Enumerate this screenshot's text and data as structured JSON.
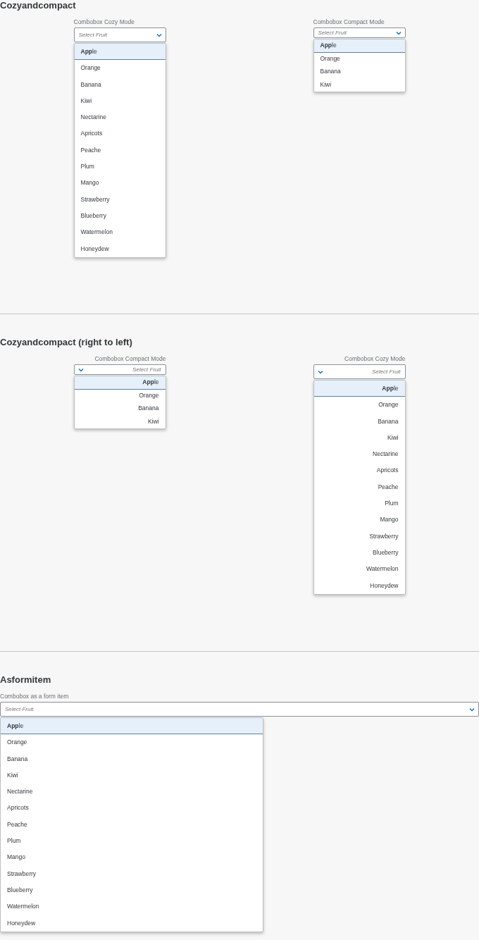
{
  "sections": [
    {
      "title": "Cozyandcompact",
      "kind": "pair",
      "comboboxes": [
        {
          "label": "Combobox Cozy Mode",
          "placeholder": "Select Fruit",
          "compact": false,
          "right_to_left": false,
          "options": [
            {
              "text": "**App**le",
              "selected": true
            },
            {
              "text": "Orange",
              "selected": false
            },
            {
              "text": "Banana",
              "selected": false
            },
            {
              "text": "Kiwi",
              "selected": false
            },
            {
              "text": "Nectarine",
              "selected": false
            },
            {
              "text": "Apricots",
              "selected": false
            },
            {
              "text": "Peache",
              "selected": false
            },
            {
              "text": "Plum",
              "selected": false
            },
            {
              "text": "Mango",
              "selected": false
            },
            {
              "text": "Strawberry",
              "selected": false
            },
            {
              "text": "Blueberry",
              "selected": false
            },
            {
              "text": "Watermelon",
              "selected": false
            },
            {
              "text": "Honeydew",
              "selected": false
            }
          ]
        },
        {
          "label": "Combobox Compact Mode",
          "placeholder": "Select Fruit",
          "compact": true,
          "right_to_left": false,
          "options": [
            {
              "text": "**App**le",
              "selected": true
            },
            {
              "text": "Orange",
              "selected": false
            },
            {
              "text": "Banana",
              "selected": false
            },
            {
              "text": "Kiwi",
              "selected": false
            }
          ]
        }
      ]
    },
    {
      "title": "Cozyandcompact (right to left)",
      "kind": "pair",
      "comboboxes": [
        {
          "label": "Combobox Compact Mode",
          "placeholder": "Select Fruit",
          "compact": true,
          "right_to_left": true,
          "options": [
            {
              "text": "**App**le",
              "selected": true
            },
            {
              "text": "Orange",
              "selected": false
            },
            {
              "text": "Banana",
              "selected": false
            },
            {
              "text": "Kiwi",
              "selected": false
            }
          ]
        },
        {
          "label": "Combobox Cozy Mode",
          "placeholder": "Select Fruit",
          "compact": false,
          "right_to_left": true,
          "options": [
            {
              "text": "**App**le",
              "selected": true
            },
            {
              "text": "Orange",
              "selected": false
            },
            {
              "text": "Banana",
              "selected": false
            },
            {
              "text": "Kiwi",
              "selected": false
            },
            {
              "text": "Nectarine",
              "selected": false
            },
            {
              "text": "Apricots",
              "selected": false
            },
            {
              "text": "Peache",
              "selected": false
            },
            {
              "text": "Plum",
              "selected": false
            },
            {
              "text": "Mango",
              "selected": false
            },
            {
              "text": "Strawberry",
              "selected": false
            },
            {
              "text": "Blueberry",
              "selected": false
            },
            {
              "text": "Watermelon",
              "selected": false
            },
            {
              "text": "Honeydew",
              "selected": false
            }
          ]
        }
      ]
    },
    {
      "title": "Asformitem",
      "kind": "form",
      "comboboxes": [
        {
          "label": "Combobox as a form item",
          "placeholder": "Select Fruit",
          "compact": false,
          "right_to_left": false,
          "options": [
            {
              "text": "**App**le",
              "selected": true
            },
            {
              "text": "Orange",
              "selected": false
            },
            {
              "text": "Banana",
              "selected": false
            },
            {
              "text": "Kiwi",
              "selected": false
            },
            {
              "text": "Nectarine",
              "selected": false
            },
            {
              "text": "Apricots",
              "selected": false
            },
            {
              "text": "Peache",
              "selected": false
            },
            {
              "text": "Plum",
              "selected": false
            },
            {
              "text": "Mango",
              "selected": false
            },
            {
              "text": "Strawberry",
              "selected": false
            },
            {
              "text": "Blueberry",
              "selected": false
            },
            {
              "text": "Watermelon",
              "selected": false
            },
            {
              "text": "Honeydew",
              "selected": false
            }
          ]
        }
      ]
    }
  ]
}
